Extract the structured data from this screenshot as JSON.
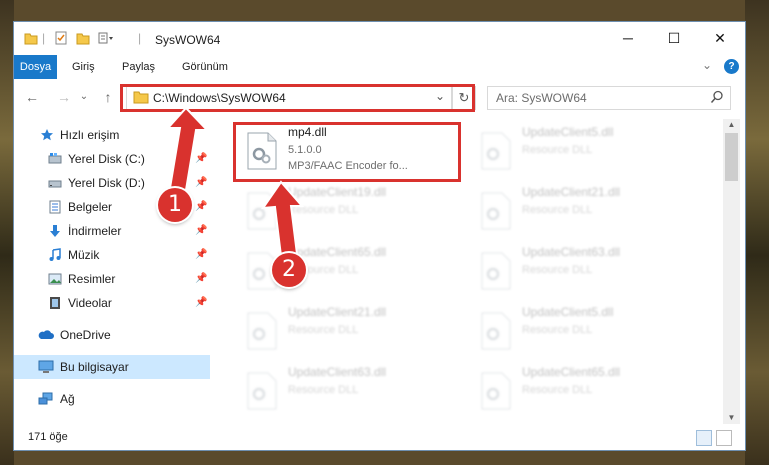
{
  "window": {
    "title": "SysWOW64",
    "caption": {
      "minimize": "─",
      "maximize": "☐",
      "close": "✕"
    }
  },
  "ribbon": {
    "tabs": [
      {
        "label": "Dosya",
        "active": true
      },
      {
        "label": "Giriş"
      },
      {
        "label": "Paylaş"
      },
      {
        "label": "Görünüm"
      }
    ],
    "expand": "⌄",
    "help": "?"
  },
  "address": {
    "path": "C:\\Windows\\SysWOW64",
    "dropdown": "⌄",
    "refresh": "↻",
    "search_placeholder": "Ara: SysWOW64"
  },
  "nav": {
    "back": "←",
    "forward": "→",
    "recent": "⌄",
    "up": "↑"
  },
  "sidebar": {
    "items": [
      {
        "label": "Hızlı erişim",
        "icon": "star-icon"
      },
      {
        "label": "Yerel Disk (C:)",
        "icon": "drive-icon",
        "pinned": true
      },
      {
        "label": "Yerel Disk (D:)",
        "icon": "drive-icon",
        "pinned": true
      },
      {
        "label": "Belgeler",
        "icon": "documents-icon",
        "pinned": true
      },
      {
        "label": "İndirmeler",
        "icon": "downloads-icon",
        "pinned": true
      },
      {
        "label": "Müzik",
        "icon": "music-icon",
        "pinned": true
      },
      {
        "label": "Resimler",
        "icon": "pictures-icon",
        "pinned": true
      },
      {
        "label": "Videolar",
        "icon": "videos-icon",
        "pinned": true
      },
      {
        "label": "OneDrive",
        "icon": "cloud-icon"
      },
      {
        "label": "Bu bilgisayar",
        "icon": "computer-icon",
        "selected": true
      },
      {
        "label": "Ağ",
        "icon": "network-icon"
      }
    ]
  },
  "files": [
    {
      "name": "mp4.dll",
      "line2": "5.1.0.0",
      "line3": "MP3/FAAC Encoder fo...",
      "highlighted": true
    },
    {
      "name": "UpdateClient5.dll",
      "line2": "Resource DLL"
    },
    {
      "name": "UpdateClient19.dll",
      "line2": "Resource DLL"
    },
    {
      "name": "UpdateClient21.dll",
      "line2": "Resource DLL"
    },
    {
      "name": "UpdateClient65.dll",
      "line2": "Resource DLL"
    },
    {
      "name": "UpdateClient63.dll",
      "line2": "Resource DLL"
    },
    {
      "name": "UpdateClient21.dll",
      "line2": "Resource DLL"
    },
    {
      "name": "UpdateClient5.dll",
      "line2": "Resource DLL"
    },
    {
      "name": "UpdateClient63.dll",
      "line2": "Resource DLL"
    },
    {
      "name": "UpdateClient65.dll",
      "line2": "Resource DLL"
    }
  ],
  "status": {
    "item_count": "171 öğe"
  },
  "annotations": {
    "marker1": "1",
    "marker2": "2",
    "color": "#d9322e"
  },
  "colors": {
    "accent": "#1979ca",
    "selected": "#cce8ff"
  }
}
